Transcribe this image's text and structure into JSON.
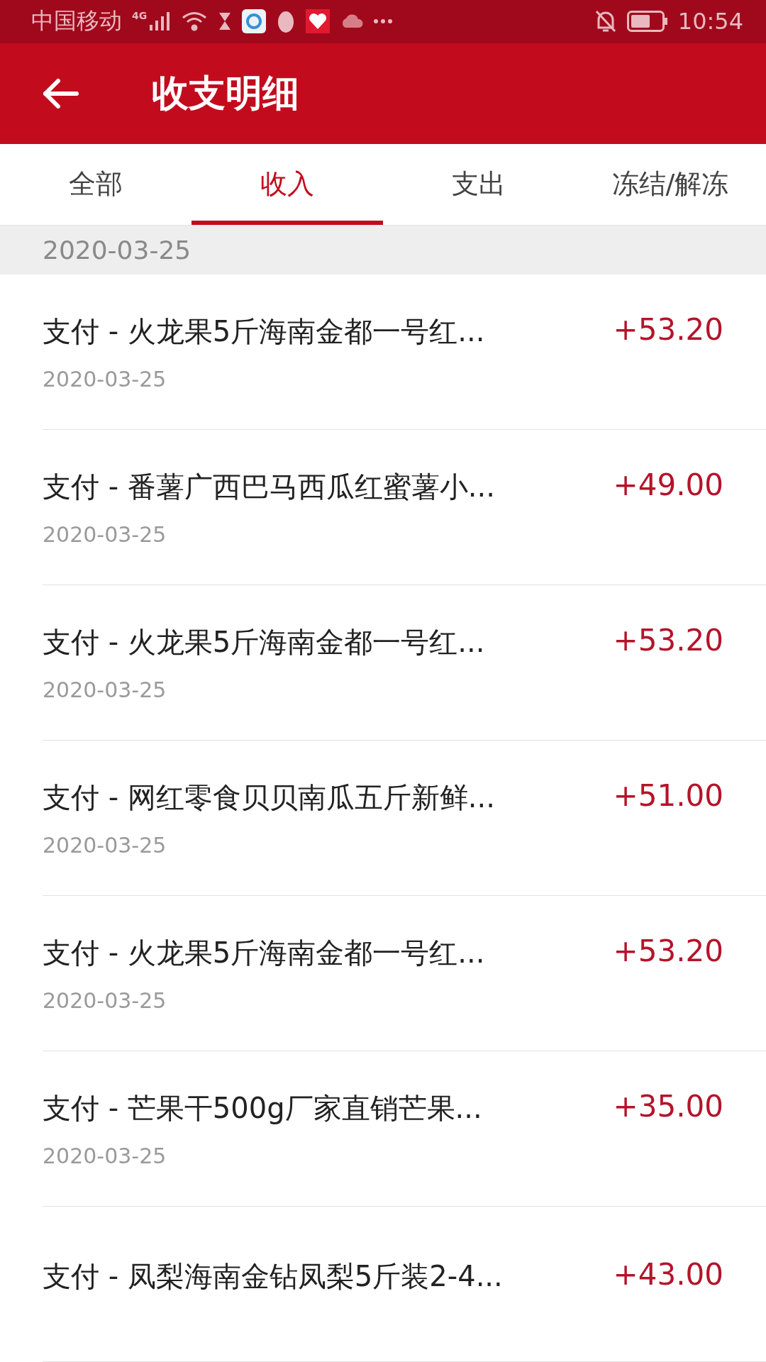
{
  "status_bar": {
    "carrier": "中国移动",
    "network": "4G",
    "time": "10:54"
  },
  "header": {
    "title": "收支明细"
  },
  "tabs": [
    {
      "label": "全部",
      "selected": false
    },
    {
      "label": "收入",
      "selected": true
    },
    {
      "label": "支出",
      "selected": false
    },
    {
      "label": "冻结/解冻",
      "selected": false
    }
  ],
  "section": {
    "date": "2020-03-25"
  },
  "transactions": [
    {
      "title": "支付 - 火龙果5斤海南金都一号红...",
      "date": "2020-03-25",
      "amount": "+53.20"
    },
    {
      "title": "支付 - 番薯广西巴马西瓜红蜜薯小...",
      "date": "2020-03-25",
      "amount": "+49.00"
    },
    {
      "title": "支付 - 火龙果5斤海南金都一号红...",
      "date": "2020-03-25",
      "amount": "+53.20"
    },
    {
      "title": "支付 - 网红零食贝贝南瓜五斤新鲜...",
      "date": "2020-03-25",
      "amount": "+51.00"
    },
    {
      "title": "支付 - 火龙果5斤海南金都一号红...",
      "date": "2020-03-25",
      "amount": "+53.20"
    },
    {
      "title": "支付 - 芒果干500g厂家直销芒果...",
      "date": "2020-03-25",
      "amount": "+35.00"
    },
    {
      "title": "支付 - 凤梨海南金钻凤梨5斤装2-4...",
      "amount": "+43.00"
    }
  ]
}
